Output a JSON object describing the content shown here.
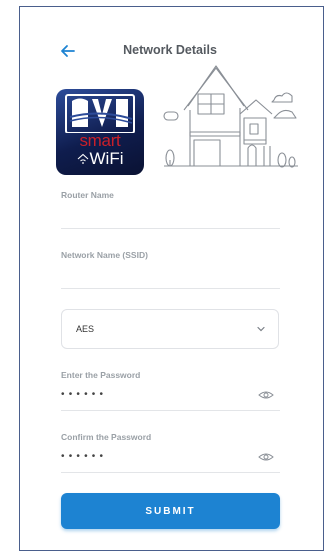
{
  "header": {
    "title": "Network Details",
    "back_icon": "arrow-left-icon"
  },
  "logo": {
    "top_text": "",
    "smart_text": "smart",
    "wifi_text": "WiFi"
  },
  "fields": {
    "router_name": {
      "label": "Router Name",
      "value": ""
    },
    "ssid": {
      "label": "Network Name (SSID)",
      "value": ""
    },
    "security": {
      "selected": "AES",
      "caret_icon": "chevron-down-icon"
    },
    "password": {
      "label": "Enter the Password",
      "mask": "••••••",
      "eye_icon": "eye-icon"
    },
    "confirm_password": {
      "label": "Confirm the Password",
      "mask": "••••••",
      "eye_icon": "eye-icon"
    }
  },
  "submit": {
    "label": "SUBMIT"
  },
  "colors": {
    "accent": "#1d83d2",
    "label": "#9aa0a6",
    "title": "#555a60",
    "logo_red": "#c8202a"
  }
}
